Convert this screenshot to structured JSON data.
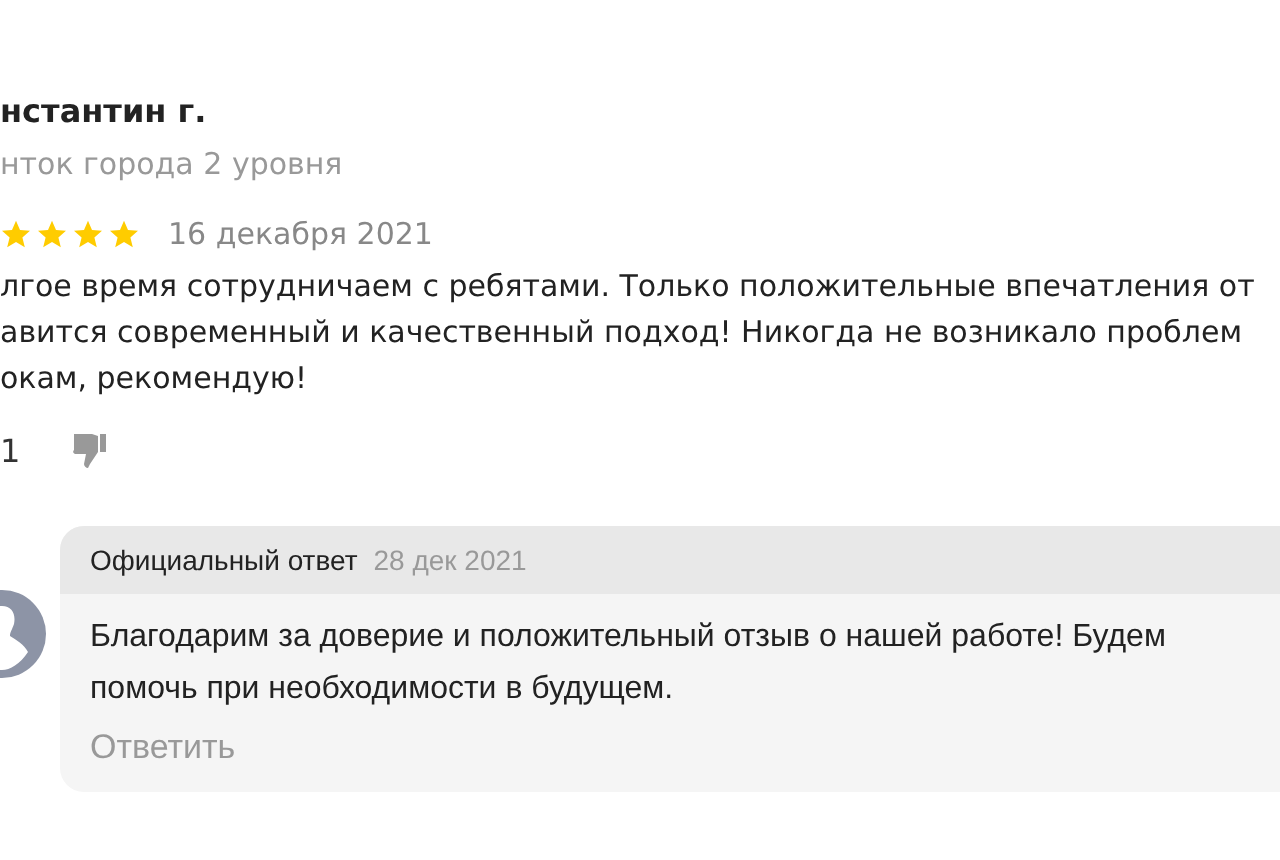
{
  "review": {
    "author": "нстантин г.",
    "author_level": "нток города 2 уровня",
    "stars": 4,
    "date": "16 декабря 2021",
    "text_lines": [
      "лгое время сотрудничаем с ребятами. Только положительные впечатления от",
      "авится современный и качественный подход! Никогда не возникало проблем",
      "окам, рекомендую!"
    ],
    "likes": "1"
  },
  "reply": {
    "title": "Официальный ответ",
    "date": "28 дек 2021",
    "text_lines": [
      "Благодарим за доверие и положительный отзыв о нашей работе! Будем",
      "помочь при необходимости в будущем."
    ],
    "action": "Ответить"
  }
}
